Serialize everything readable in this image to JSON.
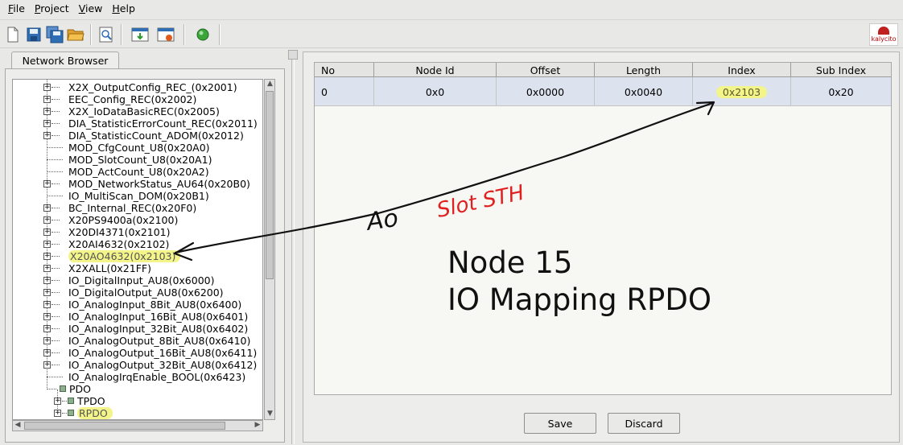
{
  "menu": [
    {
      "mnemonic": "F",
      "rest": "ile"
    },
    {
      "mnemonic": "P",
      "rest": "roject"
    },
    {
      "mnemonic": "V",
      "rest": "iew"
    },
    {
      "mnemonic": "H",
      "rest": "elp"
    }
  ],
  "toolbar": {
    "icons": [
      "new-file-icon",
      "save-icon",
      "save-all-icon",
      "open-folder-icon",
      "preview-icon",
      "import-icon",
      "export-icon",
      "connect-icon"
    ],
    "brand_text": "kalycito"
  },
  "network_browser": {
    "tab_label": "Network Browser",
    "tree": [
      {
        "label": "X2X_OutputConfig_REC_(0x2001)",
        "kind": "expandable"
      },
      {
        "label": "EEC_Config_REC(0x2002)",
        "kind": "expandable"
      },
      {
        "label": "X2X_IoDataBasicREC(0x2005)",
        "kind": "expandable"
      },
      {
        "label": "DIA_StatisticErrorCount_REC(0x2011)",
        "kind": "expandable"
      },
      {
        "label": "DIA_StatisticCount_ADOM(0x2012)",
        "kind": "expandable"
      },
      {
        "label": "MOD_CfgCount_U8(0x20A0)",
        "kind": "leaf"
      },
      {
        "label": "MOD_SlotCount_U8(0x20A1)",
        "kind": "leaf"
      },
      {
        "label": "MOD_ActCount_U8(0x20A2)",
        "kind": "leaf"
      },
      {
        "label": "MOD_NetworkStatus_AU64(0x20B0)",
        "kind": "expandable"
      },
      {
        "label": "IO_MultiScan_DOM(0x20B1)",
        "kind": "leaf"
      },
      {
        "label": "BC_Internal_REC(0x20F0)",
        "kind": "expandable"
      },
      {
        "label": "X20PS9400a(0x2100)",
        "kind": "expandable"
      },
      {
        "label": "X20DI4371(0x2101)",
        "kind": "expandable"
      },
      {
        "label": "X20AI4632(0x2102)",
        "kind": "expandable"
      },
      {
        "label": "X20AO4632(0x2103)",
        "kind": "expandable",
        "highlight": true
      },
      {
        "label": "X2XALL(0x21FF)",
        "kind": "expandable"
      },
      {
        "label": "IO_DigitalInput_AU8(0x6000)",
        "kind": "expandable"
      },
      {
        "label": "IO_DigitalOutput_AU8(0x6200)",
        "kind": "expandable"
      },
      {
        "label": "IO_AnalogInput_8Bit_AU8(0x6400)",
        "kind": "expandable"
      },
      {
        "label": "IO_AnalogInput_16Bit_AU8(0x6401)",
        "kind": "expandable"
      },
      {
        "label": "IO_AnalogInput_32Bit_AU8(0x6402)",
        "kind": "expandable"
      },
      {
        "label": "IO_AnalogOutput_8Bit_AU8(0x6410)",
        "kind": "expandable"
      },
      {
        "label": "IO_AnalogOutput_16Bit_AU8(0x6411)",
        "kind": "expandable"
      },
      {
        "label": "IO_AnalogOutput_32Bit_AU8(0x6412)",
        "kind": "expandable"
      },
      {
        "label": "IO_AnalogIrqEnable_BOOL(0x6423)",
        "kind": "leaf"
      },
      {
        "label": "PDO",
        "kind": "open-parent"
      },
      {
        "label": "TPDO",
        "kind": "child-expandable"
      },
      {
        "label": "RPDO",
        "kind": "child-expandable",
        "highlight": true
      }
    ]
  },
  "mapping_table": {
    "columns": [
      "No",
      "Node Id",
      "Offset",
      "Length",
      "Index",
      "Sub Index"
    ],
    "rows": [
      {
        "No": "0",
        "Node Id": "0x0",
        "Offset": "0x0000",
        "Length": "0x0040",
        "Index": "0x2103",
        "Sub Index": "0x20"
      }
    ]
  },
  "note": {
    "line1": "Node 15",
    "line2": "IO Mapping RPDO"
  },
  "handwritten": {
    "black_word": "Ao",
    "red_words": "Slot STH",
    "black_color": "#111111",
    "red_color": "#e02020"
  },
  "buttons": {
    "save": "Save",
    "discard": "Discard"
  },
  "colors": {
    "highlight": "#f3f48a",
    "selected_row": "#dde3ee"
  }
}
